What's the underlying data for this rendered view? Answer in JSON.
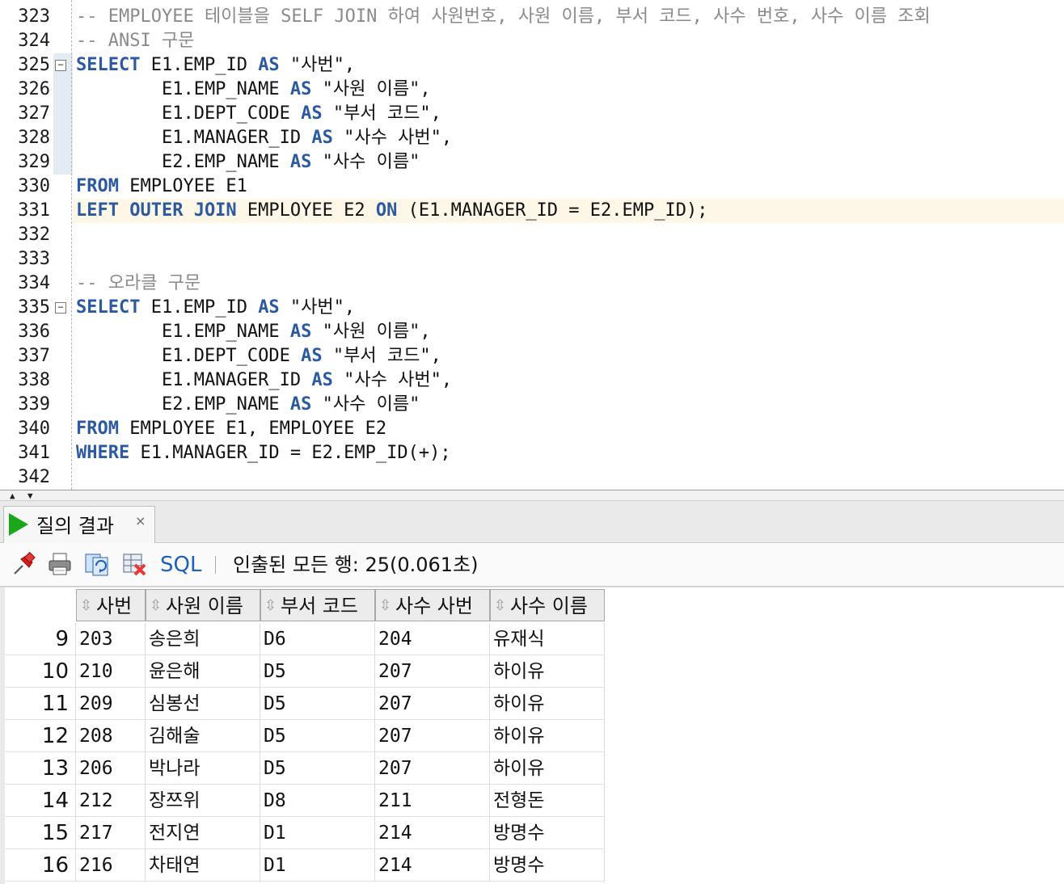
{
  "editor": {
    "lines": [
      {
        "num": "323",
        "text": "-- EMPLOYEE 테이블을 SELF JOIN 하여 사원번호, 사원 이름, 부서 코드, 사수 번호, 사수 이름 조회"
      },
      {
        "num": "324",
        "text": "-- ANSI 구문"
      },
      {
        "num": "325",
        "kw": "SELECT",
        "text": " E1.EMP_ID ",
        "kw2": "AS",
        "text2": " \"사번\","
      },
      {
        "num": "326",
        "text": "        E1.EMP_NAME ",
        "kw": "AS",
        "text2": " \"사원 이름\","
      },
      {
        "num": "327",
        "text": "        E1.DEPT_CODE ",
        "kw": "AS",
        "text2": " \"부서 코드\","
      },
      {
        "num": "328",
        "text": "        E1.MANAGER_ID ",
        "kw": "AS",
        "text2": " \"사수 사번\","
      },
      {
        "num": "329",
        "text": "        E2.EMP_NAME ",
        "kw": "AS",
        "text2": " \"사수 이름\""
      },
      {
        "num": "330",
        "kw": "FROM",
        "text": " EMPLOYEE E1"
      },
      {
        "num": "331",
        "kw": "LEFT OUTER JOIN",
        "text": " EMPLOYEE E2 ",
        "kw2": "ON",
        "text2": " (E1.MANAGER_ID = E2.EMP_ID);"
      },
      {
        "num": "332",
        "text": ""
      },
      {
        "num": "333",
        "text": ""
      },
      {
        "num": "334",
        "text": "-- 오라클 구문"
      },
      {
        "num": "335",
        "kw": "SELECT",
        "text": " E1.EMP_ID ",
        "kw2": "AS",
        "text2": " \"사번\","
      },
      {
        "num": "336",
        "text": "        E1.EMP_NAME ",
        "kw": "AS",
        "text2": " \"사원 이름\","
      },
      {
        "num": "337",
        "text": "        E1.DEPT_CODE ",
        "kw": "AS",
        "text2": " \"부서 코드\","
      },
      {
        "num": "338",
        "text": "        E1.MANAGER_ID ",
        "kw": "AS",
        "text2": " \"사수 사번\","
      },
      {
        "num": "339",
        "text": "        E2.EMP_NAME ",
        "kw": "AS",
        "text2": " \"사수 이름\""
      },
      {
        "num": "340",
        "kw": "FROM",
        "text": " EMPLOYEE E1, EMPLOYEE E2"
      },
      {
        "num": "341",
        "kw": "WHERE",
        "text": " E1.MANAGER_ID = E2.EMP_ID(+);"
      },
      {
        "num": "342",
        "text": ""
      }
    ],
    "fold_glyph": "−"
  },
  "results": {
    "tab_title": "질의 결과",
    "tab_close": "×",
    "sql_label": "SQL",
    "status": "인출된 모든 행: 25(0.061초)",
    "sort_glyph": "⇳",
    "columns": [
      "사번",
      "사원 이름",
      "부서 코드",
      "사수 사번",
      "사수 이름"
    ],
    "rows": [
      [
        "9",
        "203",
        "송은희",
        "D6",
        "204",
        "유재식"
      ],
      [
        "10",
        "210",
        "윤은해",
        "D5",
        "207",
        "하이유"
      ],
      [
        "11",
        "209",
        "심봉선",
        "D5",
        "207",
        "하이유"
      ],
      [
        "12",
        "208",
        "김해술",
        "D5",
        "207",
        "하이유"
      ],
      [
        "13",
        "206",
        "박나라",
        "D5",
        "207",
        "하이유"
      ],
      [
        "14",
        "212",
        "장쯔위",
        "D8",
        "211",
        "전형돈"
      ],
      [
        "15",
        "217",
        "전지연",
        "D1",
        "214",
        "방명수"
      ],
      [
        "16",
        "216",
        "차태연",
        "D1",
        "214",
        "방명수"
      ]
    ]
  },
  "colors": {
    "keyword": "#2c5aa0",
    "comment": "#8a8a8a",
    "current_line": "#fcf7e6",
    "run_icon": "#1aa81a",
    "sql_link": "#1f5fbf"
  },
  "icons": [
    "pin-icon",
    "print-icon",
    "refresh-icon",
    "delete-icon"
  ]
}
